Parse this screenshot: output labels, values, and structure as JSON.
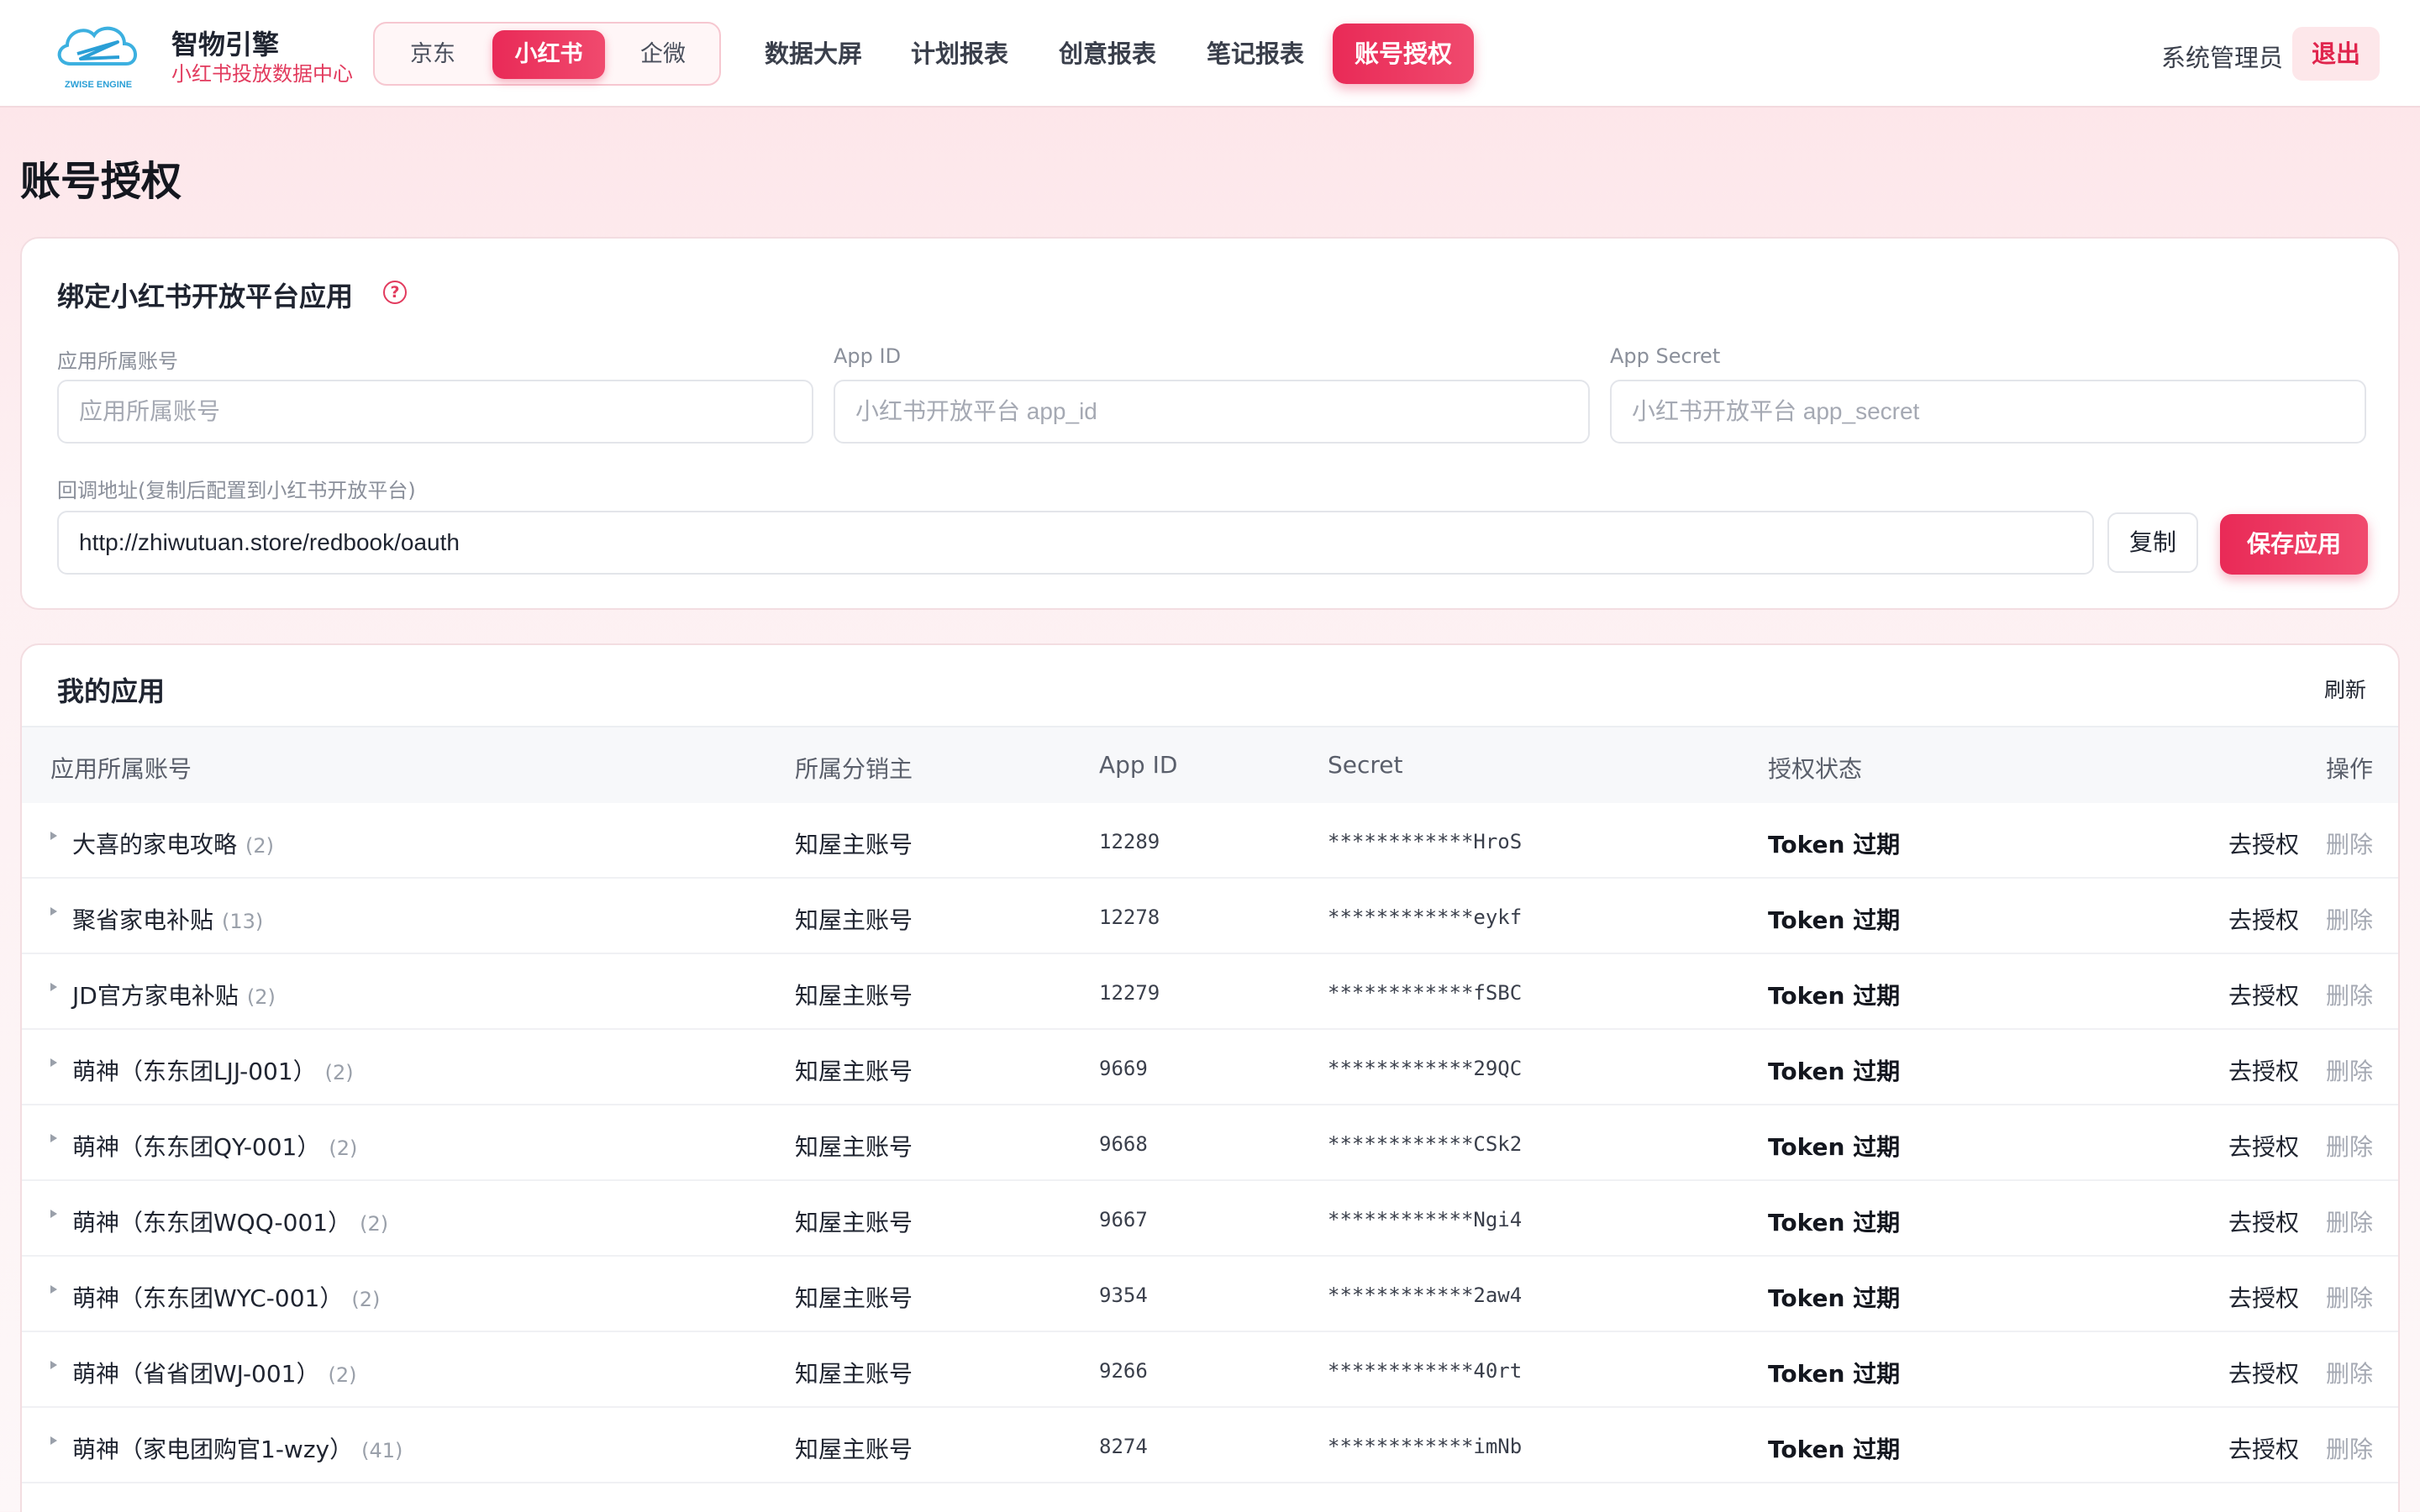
{
  "brand": {
    "logo_text": "ZWISE ENGINE",
    "name": "智物引擎",
    "subtitle": "小红书投放数据中心"
  },
  "platforms": [
    {
      "label": "京东",
      "active": false
    },
    {
      "label": "小红书",
      "active": true
    },
    {
      "label": "企微",
      "active": false
    }
  ],
  "nav": [
    {
      "label": "数据大屏",
      "active": false
    },
    {
      "label": "计划报表",
      "active": false
    },
    {
      "label": "创意报表",
      "active": false
    },
    {
      "label": "笔记报表",
      "active": false
    },
    {
      "label": "账号授权",
      "active": true
    }
  ],
  "user": {
    "name": "系统管理员",
    "logout_label": "退出"
  },
  "page_title": "账号授权",
  "bind_form": {
    "title": "绑定小红书开放平台应用",
    "help_icon": "question-circle-icon",
    "account_label": "应用所属账号",
    "account_placeholder": "应用所属账号",
    "app_id_label": "App ID",
    "app_id_placeholder": "小红书开放平台 app_id",
    "app_secret_label": "App Secret",
    "app_secret_placeholder": "小红书开放平台 app_secret",
    "callback_label": "回调地址(复制后配置到小红书开放平台)",
    "callback_value": "http://zhiwutuan.store/redbook/oauth",
    "copy_label": "复制",
    "save_label": "保存应用"
  },
  "apps": {
    "title": "我的应用",
    "refresh_label": "刷新",
    "columns": [
      "应用所属账号",
      "所属分销主",
      "App ID",
      "Secret",
      "授权状态",
      "操作"
    ],
    "rows": [
      {
        "name": "大喜的家电攻略",
        "count": "(2)",
        "distributor": "知屋主账号",
        "app_id": "12289",
        "secret": "************HroS",
        "status": "Token 过期",
        "auth": "去授权",
        "delete": "删除"
      },
      {
        "name": "聚省家电补贴",
        "count": "(13)",
        "distributor": "知屋主账号",
        "app_id": "12278",
        "secret": "************eykf",
        "status": "Token 过期",
        "auth": "去授权",
        "delete": "删除"
      },
      {
        "name": "JD官方家电补贴",
        "count": "(2)",
        "distributor": "知屋主账号",
        "app_id": "12279",
        "secret": "************fSBC",
        "status": "Token 过期",
        "auth": "去授权",
        "delete": "删除"
      },
      {
        "name": "萌神（东东团LJJ-001）",
        "count": "(2)",
        "distributor": "知屋主账号",
        "app_id": "9669",
        "secret": "************29QC",
        "status": "Token 过期",
        "auth": "去授权",
        "delete": "删除"
      },
      {
        "name": "萌神（东东团QY-001）",
        "count": "(2)",
        "distributor": "知屋主账号",
        "app_id": "9668",
        "secret": "************CSk2",
        "status": "Token 过期",
        "auth": "去授权",
        "delete": "删除"
      },
      {
        "name": "萌神（东东团WQQ-001）",
        "count": "(2)",
        "distributor": "知屋主账号",
        "app_id": "9667",
        "secret": "************Ngi4",
        "status": "Token 过期",
        "auth": "去授权",
        "delete": "删除"
      },
      {
        "name": "萌神（东东团WYC-001）",
        "count": "(2)",
        "distributor": "知屋主账号",
        "app_id": "9354",
        "secret": "************2aw4",
        "status": "Token 过期",
        "auth": "去授权",
        "delete": "删除"
      },
      {
        "name": "萌神（省省团WJ-001）",
        "count": "(2)",
        "distributor": "知屋主账号",
        "app_id": "9266",
        "secret": "************40rt",
        "status": "Token 过期",
        "auth": "去授权",
        "delete": "删除"
      },
      {
        "name": "萌神（家电团购官1-wzy）",
        "count": "(41)",
        "distributor": "知屋主账号",
        "app_id": "8274",
        "secret": "************imNb",
        "status": "Token 过期",
        "auth": "去授权",
        "delete": "删除"
      }
    ]
  },
  "colors": {
    "accent": "#e92a57",
    "accent_text": "#e23b5e"
  }
}
